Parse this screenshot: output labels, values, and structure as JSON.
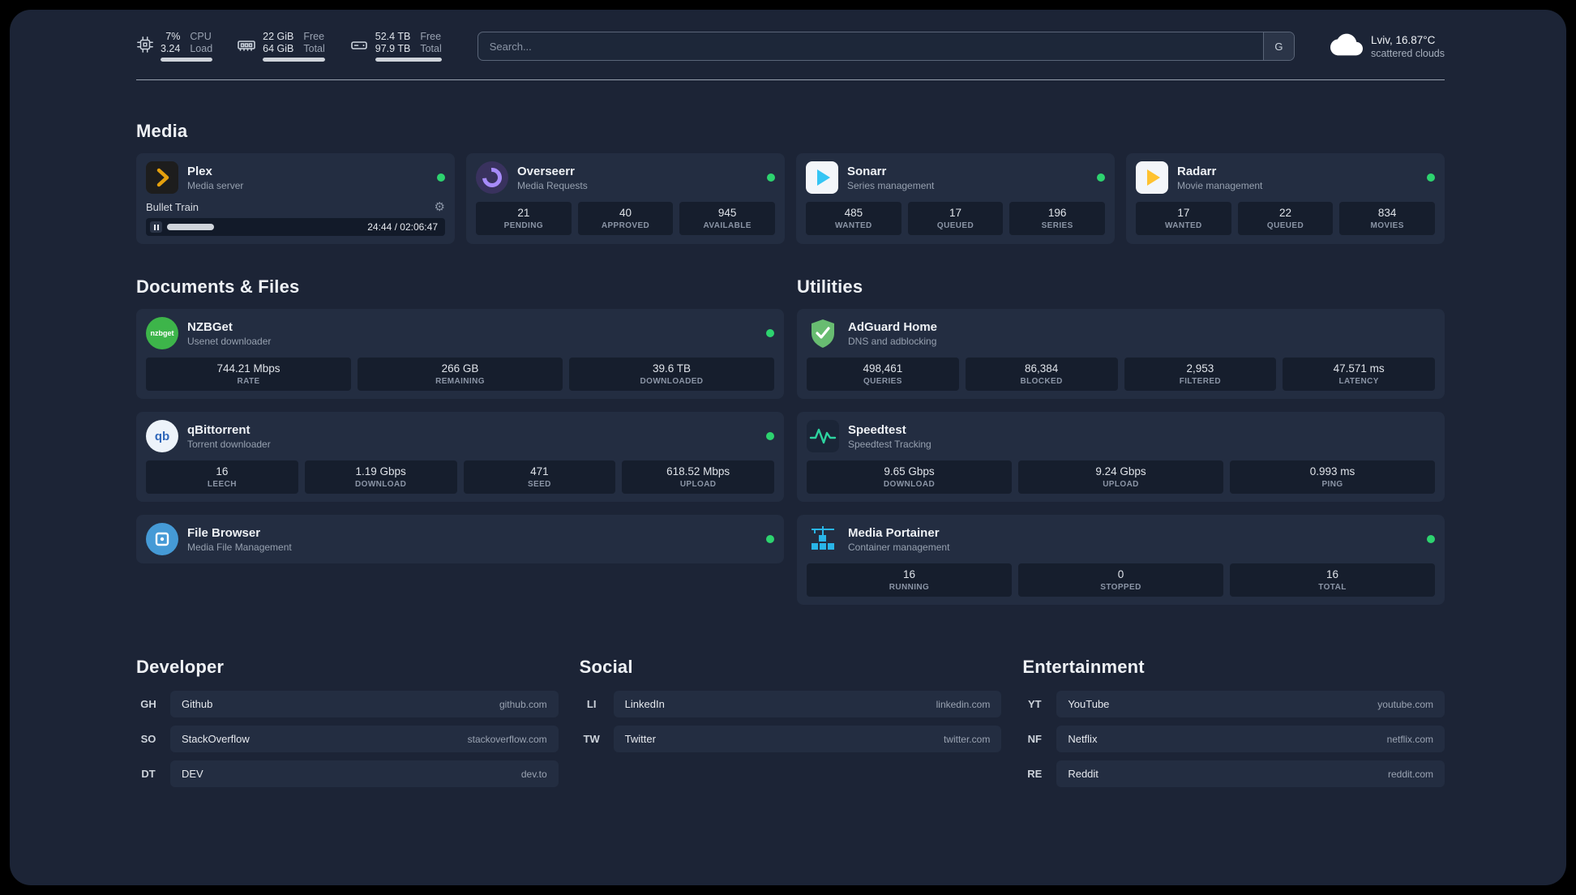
{
  "topbar": {
    "cpu": {
      "value1": "7%",
      "label1": "CPU",
      "value2": "3.24",
      "label2": "Load"
    },
    "ram": {
      "value1": "22 GiB",
      "label1": "Free",
      "value2": "64 GiB",
      "label2": "Total"
    },
    "disk": {
      "value1": "52.4 TB",
      "label1": "Free",
      "value2": "97.9 TB",
      "label2": "Total"
    },
    "search": {
      "placeholder": "Search...",
      "button_label": "G"
    },
    "weather": {
      "location": "Lviv, 16.87°C",
      "condition": "scattered clouds"
    }
  },
  "sections": {
    "media": {
      "title": "Media"
    },
    "documents": {
      "title": "Documents & Files"
    },
    "utilities": {
      "title": "Utilities"
    },
    "developer": {
      "title": "Developer"
    },
    "social": {
      "title": "Social"
    },
    "entertainment": {
      "title": "Entertainment"
    }
  },
  "services": {
    "plex": {
      "name": "Plex",
      "description": "Media server",
      "player": {
        "track": "Bullet Train",
        "time": "24:44 / 02:06:47"
      }
    },
    "overseerr": {
      "name": "Overseerr",
      "description": "Media Requests",
      "stats": [
        {
          "value": "21",
          "label": "PENDING"
        },
        {
          "value": "40",
          "label": "APPROVED"
        },
        {
          "value": "945",
          "label": "AVAILABLE"
        }
      ]
    },
    "sonarr": {
      "name": "Sonarr",
      "description": "Series management",
      "stats": [
        {
          "value": "485",
          "label": "WANTED"
        },
        {
          "value": "17",
          "label": "QUEUED"
        },
        {
          "value": "196",
          "label": "SERIES"
        }
      ]
    },
    "radarr": {
      "name": "Radarr",
      "description": "Movie management",
      "stats": [
        {
          "value": "17",
          "label": "WANTED"
        },
        {
          "value": "22",
          "label": "QUEUED"
        },
        {
          "value": "834",
          "label": "MOVIES"
        }
      ]
    },
    "nzbget": {
      "name": "NZBGet",
      "description": "Usenet downloader",
      "stats": [
        {
          "value": "744.21 Mbps",
          "label": "RATE"
        },
        {
          "value": "266 GB",
          "label": "REMAINING"
        },
        {
          "value": "39.6 TB",
          "label": "DOWNLOADED"
        }
      ]
    },
    "qbittorrent": {
      "name": "qBittorrent",
      "description": "Torrent downloader",
      "stats": [
        {
          "value": "16",
          "label": "LEECH"
        },
        {
          "value": "1.19 Gbps",
          "label": "DOWNLOAD"
        },
        {
          "value": "471",
          "label": "SEED"
        },
        {
          "value": "618.52 Mbps",
          "label": "UPLOAD"
        }
      ]
    },
    "filebrowser": {
      "name": "File Browser",
      "description": "Media File Management"
    },
    "adguard": {
      "name": "AdGuard Home",
      "description": "DNS and adblocking",
      "stats": [
        {
          "value": "498,461",
          "label": "QUERIES"
        },
        {
          "value": "86,384",
          "label": "BLOCKED"
        },
        {
          "value": "2,953",
          "label": "FILTERED"
        },
        {
          "value": "47.571 ms",
          "label": "LATENCY"
        }
      ]
    },
    "speedtest": {
      "name": "Speedtest",
      "description": "Speedtest Tracking",
      "stats": [
        {
          "value": "9.65 Gbps",
          "label": "DOWNLOAD"
        },
        {
          "value": "9.24 Gbps",
          "label": "UPLOAD"
        },
        {
          "value": "0.993 ms",
          "label": "PING"
        }
      ]
    },
    "portainer": {
      "name": "Media Portainer",
      "description": "Container management",
      "stats": [
        {
          "value": "16",
          "label": "RUNNING"
        },
        {
          "value": "0",
          "label": "STOPPED"
        },
        {
          "value": "16",
          "label": "TOTAL"
        }
      ]
    }
  },
  "bookmarks": {
    "developer": [
      {
        "abbr": "GH",
        "name": "Github",
        "domain": "github.com"
      },
      {
        "abbr": "SO",
        "name": "StackOverflow",
        "domain": "stackoverflow.com"
      },
      {
        "abbr": "DT",
        "name": "DEV",
        "domain": "dev.to"
      }
    ],
    "social": [
      {
        "abbr": "LI",
        "name": "LinkedIn",
        "domain": "linkedin.com"
      },
      {
        "abbr": "TW",
        "name": "Twitter",
        "domain": "twitter.com"
      }
    ],
    "entertainment": [
      {
        "abbr": "YT",
        "name": "YouTube",
        "domain": "youtube.com"
      },
      {
        "abbr": "NF",
        "name": "Netflix",
        "domain": "netflix.com"
      },
      {
        "abbr": "RE",
        "name": "Reddit",
        "domain": "reddit.com"
      }
    ]
  },
  "colors": {
    "background": "#1c2436",
    "card": "#232d41",
    "status_ok": "#2dd36f",
    "plex_amber": "#e5a00d",
    "overseerr_purple": "#a78bfa",
    "sonarr_blue": "#35c5f4",
    "radarr_yellow": "#ffc230",
    "nzbget_green": "#3db54a",
    "qbittorrent_blue": "#2f67ba",
    "adguard_green": "#68bc71",
    "speedtest_green": "#2dd4a0",
    "filebrowser_blue": "#459ad6",
    "portainer_blue": "#29b5e8"
  }
}
